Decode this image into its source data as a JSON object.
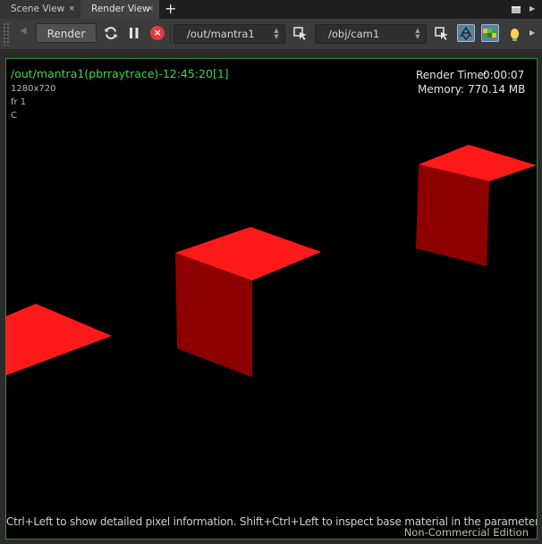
{
  "tabs": [
    {
      "label": "Scene View",
      "close": "×"
    },
    {
      "label": "Render View",
      "close": "×"
    }
  ],
  "tab_add": "+",
  "toolbar": {
    "render_label": "Render",
    "output_driver": "/out/mantra1",
    "camera": "/obj/cam1"
  },
  "render_info": {
    "title": "/out/mantra1(pbrraytrace)-12:45:20[1]",
    "resolution": "1280x720",
    "frame": "fr 1",
    "plane": "C",
    "render_time_label": "Render Time:",
    "render_time": "0:00:07",
    "memory_label": "Memory:",
    "memory": "770.14 MB"
  },
  "hint": "Ctrl+Left to show detailed pixel information. Shift+Ctrl+Left to inspect base material in the parameter dialog.",
  "edition": "Non-Commercial Edition",
  "colors": {
    "accent_green": "#49d349",
    "cube_red": "#ff1a1a",
    "stop_red": "#e23b3b"
  }
}
